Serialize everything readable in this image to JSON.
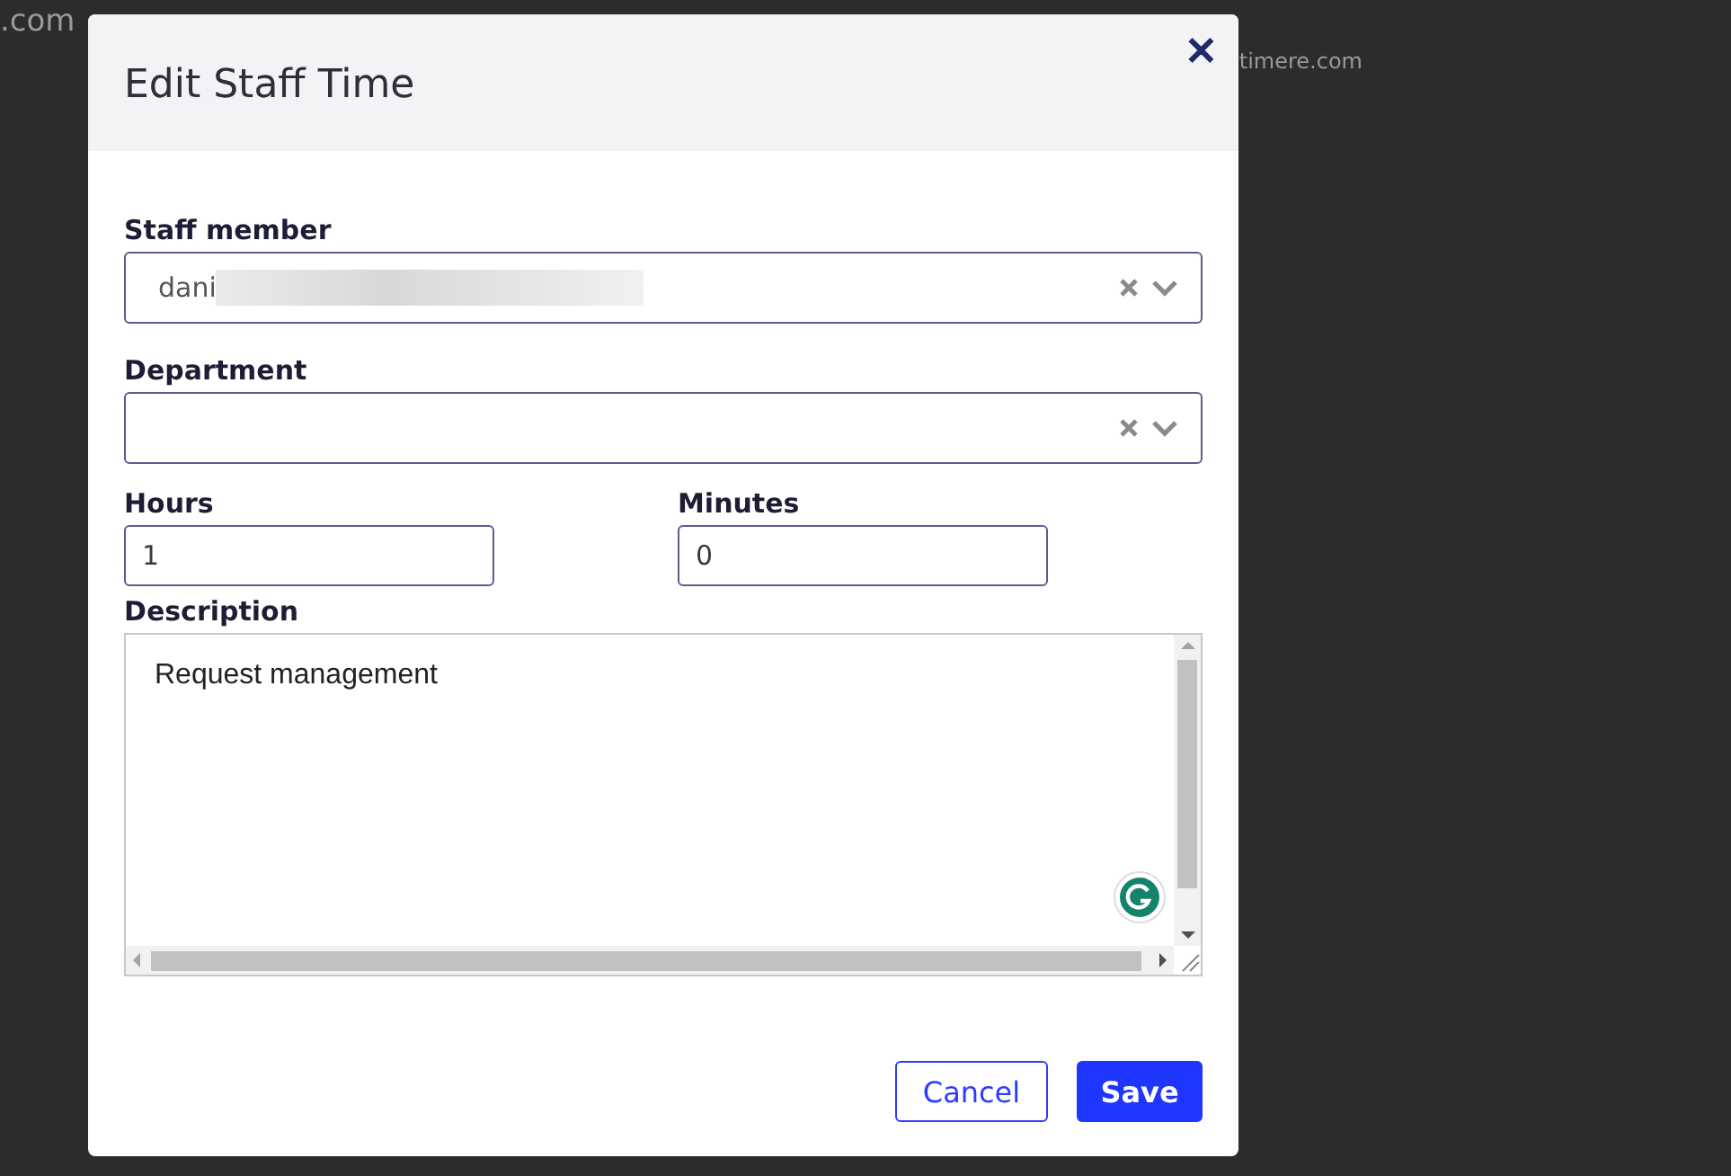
{
  "background_page": {
    "texts": [
      ".com",
      "timere.com"
    ]
  },
  "dialog": {
    "title": "Edit Staff Time",
    "close_icon": "✕",
    "fields": [
      {
        "kind": "select",
        "label": "Staff member",
        "value": "dani",
        "redacted": true
      },
      {
        "kind": "select",
        "label": "Department",
        "redacted": false
      }
    ],
    "time_fields": [
      {
        "label": "Hours",
        "value": "1"
      },
      {
        "label": "Minutes",
        "value": "0"
      }
    ],
    "description": {
      "label": "Description",
      "value": "Request management"
    },
    "buttons": [
      {
        "label": "Cancel",
        "kind": "secondary"
      },
      {
        "label": "Save",
        "kind": "primary"
      }
    ]
  }
}
